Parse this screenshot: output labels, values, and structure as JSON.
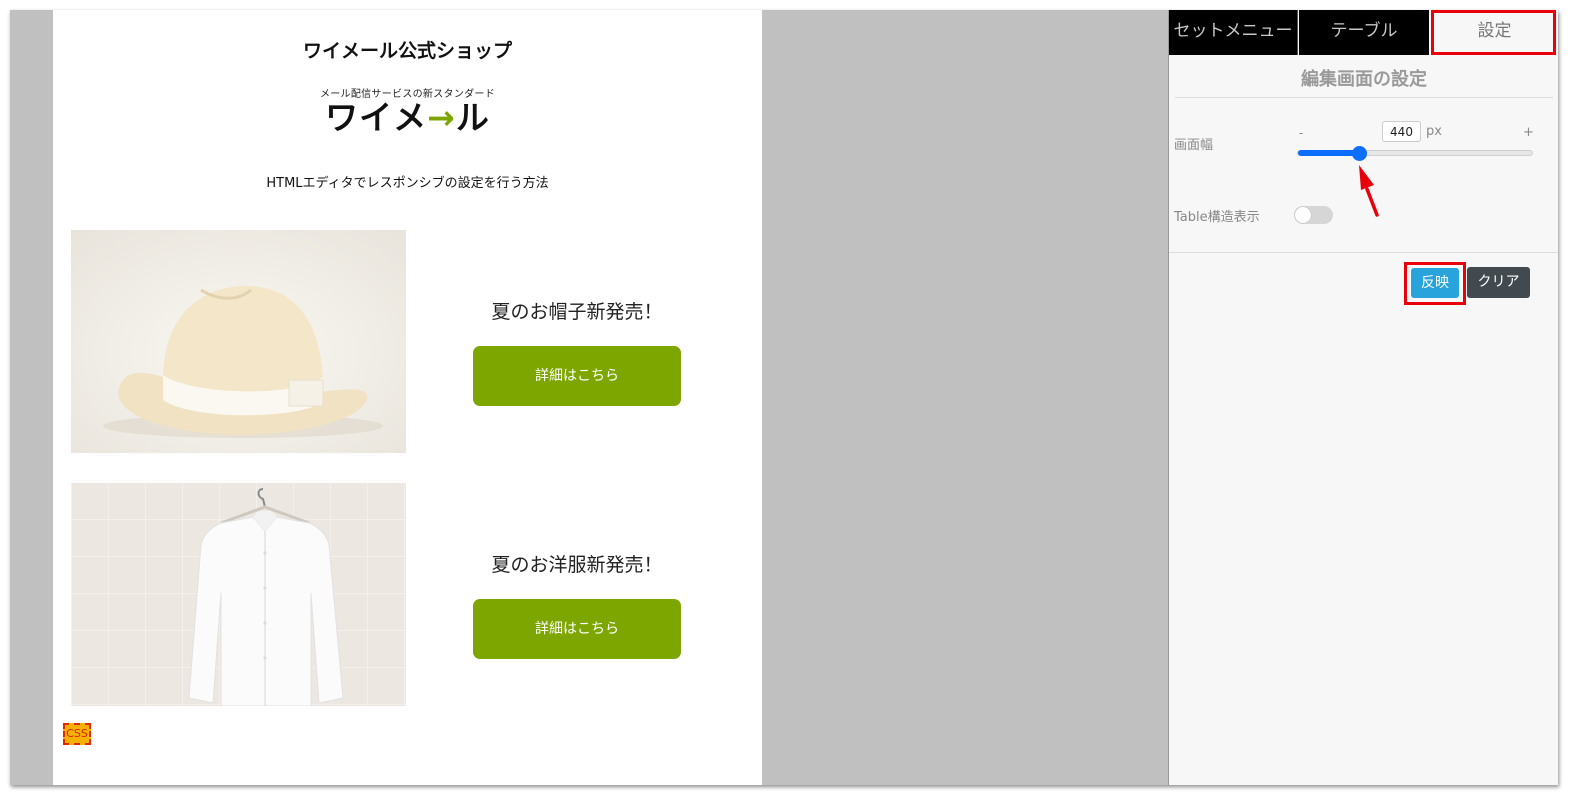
{
  "canvas": {
    "shop_title": "ワイメール公式ショップ",
    "logo_tagline": "メール配信サービスの新スタンダード",
    "logo_text_left": "ワイメ",
    "logo_text_right": "ル",
    "logo_arrow": "→",
    "subtitle": "HTMLエディタでレスポンシブの設定を行う方法",
    "products": [
      {
        "title": "夏のお帽子新発売！",
        "button": "詳細はこちら"
      },
      {
        "title": "夏のお洋服新発売！",
        "button": "詳細はこちら"
      }
    ],
    "css_badge": "CSS"
  },
  "panel": {
    "tabs": [
      "セットメニュー",
      "テーブル",
      "設定"
    ],
    "active_tab": "設定",
    "title": "編集画面の設定",
    "screen_width_label": "画面幅",
    "range_minus": "-",
    "range_plus": "+",
    "width_value": "440",
    "width_unit": "px",
    "slider_level_percent": 26,
    "table_structure_label": "Table構造表示",
    "table_structure_on": false,
    "apply_button": "反映",
    "clear_button": "クリア"
  },
  "colors": {
    "brand_green": "#7da600",
    "slider_blue": "#0d6efd",
    "apply_blue": "#29a3dc",
    "highlight_red": "#e8000b"
  }
}
